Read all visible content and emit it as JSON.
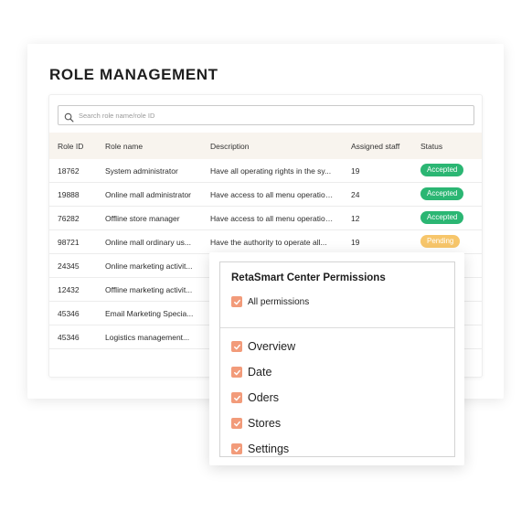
{
  "page": {
    "title": "ROLE MANAGEMENT"
  },
  "search": {
    "placeholder": "Search role name/role ID",
    "value": ""
  },
  "table": {
    "headers": {
      "id": "Role ID",
      "name": "Role name",
      "description": "Description",
      "staff": "Assigned staff",
      "status": "Status"
    },
    "rows": [
      {
        "id": "18762",
        "name": "System administrator",
        "description": "Have all operating rights in the sy...",
        "staff": "19",
        "status": "Accepted"
      },
      {
        "id": "19888",
        "name": "Online mall administrator",
        "description": "Have access to all menu operation...",
        "staff": "24",
        "status": "Accepted"
      },
      {
        "id": "76282",
        "name": "Offline store manager",
        "description": "Have access to all menu operation...",
        "staff": "12",
        "status": "Accepted"
      },
      {
        "id": "98721",
        "name": "Online mall ordinary us...",
        "description": "Have the authority to operate all...",
        "staff": "19",
        "status": "Pending"
      },
      {
        "id": "24345",
        "name": "Online marketing activit...",
        "description": "",
        "staff": "",
        "status": ""
      },
      {
        "id": "12432",
        "name": "Offline marketing activit...",
        "description": "",
        "staff": "",
        "status": ""
      },
      {
        "id": "45346",
        "name": "Email Marketing Specia...",
        "description": "",
        "staff": "",
        "status": ""
      },
      {
        "id": "45346",
        "name": "Logistics management...",
        "description": "",
        "staff": "",
        "status": ""
      }
    ]
  },
  "permissions_popup": {
    "title": "RetaSmart Center Permissions",
    "all_label": "All permissions",
    "items": [
      {
        "label": "Overview",
        "checked": true
      },
      {
        "label": "Date",
        "checked": true
      },
      {
        "label": "Oders",
        "checked": true
      },
      {
        "label": "Stores",
        "checked": true
      },
      {
        "label": "Settings",
        "checked": true
      }
    ]
  },
  "colors": {
    "accepted": "#2bb673",
    "pending": "#f7c66b",
    "checkbox": "#f29b7a",
    "header_bg": "#f8f4ee"
  },
  "icons": {
    "search": "search-icon",
    "check": "check-icon"
  }
}
